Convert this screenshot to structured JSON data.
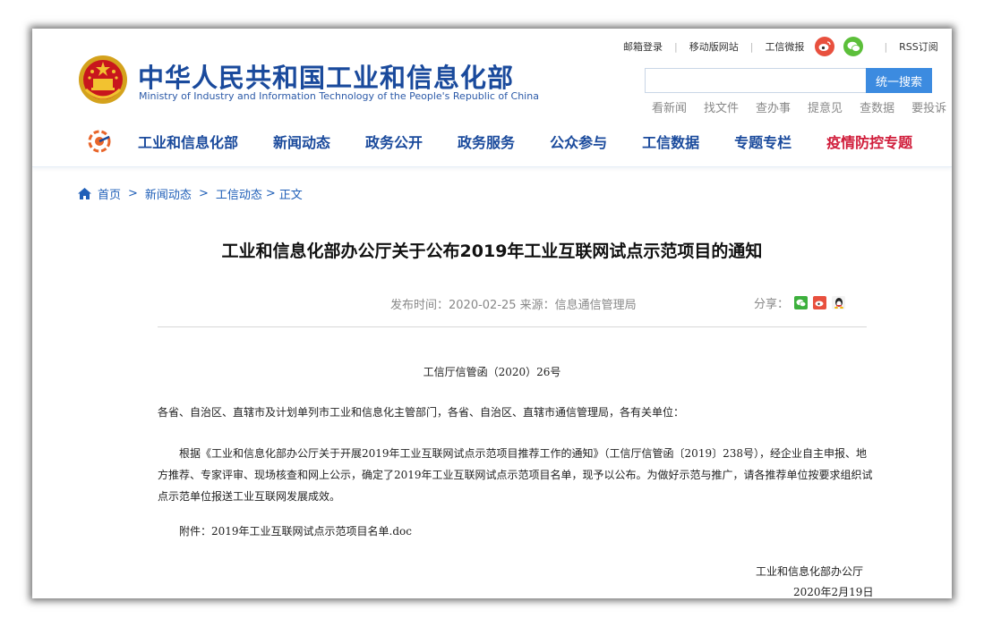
{
  "header": {
    "title_cn": "中华人民共和国工业和信息化部",
    "title_en": "Ministry of Industry and Information Technology of the People's Republic of China",
    "top_links": [
      "邮箱登录",
      "移动版网站",
      "工信微报",
      "RSS订阅"
    ],
    "search": {
      "placeholder": "",
      "button_label": "统一搜索"
    },
    "quick_links": [
      "看新闻",
      "找文件",
      "查办事",
      "提意见",
      "查数据",
      "要投诉"
    ]
  },
  "nav": {
    "items": [
      {
        "label": "工业和信息化部"
      },
      {
        "label": "新闻动态"
      },
      {
        "label": "政务公开"
      },
      {
        "label": "政务服务"
      },
      {
        "label": "公众参与"
      },
      {
        "label": "工信数据"
      },
      {
        "label": "专题专栏"
      },
      {
        "label": "疫情防控专题"
      }
    ]
  },
  "breadcrumb": {
    "items": [
      "首页",
      "新闻动态",
      "工信动态",
      "正文"
    ]
  },
  "article": {
    "title": "工业和信息化部办公厅关于公布2019年工业互联网试点示范项目的通知",
    "meta": "发布时间：2020-02-25  来源：信息通信管理局",
    "share_label": "分享：",
    "doc_number": "工信厅信管函（2020）26号",
    "salutation": "各省、自治区、直辖市及计划单列市工业和信息化主管部门，各省、自治区、直辖市通信管理局，各有关单位：",
    "body": "根据《工业和信息化部办公厅关于开展2019年工业互联网试点示范项目推荐工作的通知》（工信厅信管函〔2019〕238号），经企业自主申报、地方推荐、专家评审、现场核查和网上公示，确定了2019年工业互联网试点示范项目名单，现予以公布。为做好示范与推广，请各推荐单位按要求组织试点示范单位报送工业互联网发展成效。",
    "attachment": "附件：2019年工业互联网试点示范项目名单.doc",
    "sign_org": "工业和信息化部办公厅",
    "sign_date": "2020年2月19日"
  },
  "colors": {
    "brand_blue": "#1a4a9c",
    "search_button": "#3c8be0",
    "covid_red": "#d01c3a",
    "link_blue": "#1f5fb8"
  }
}
